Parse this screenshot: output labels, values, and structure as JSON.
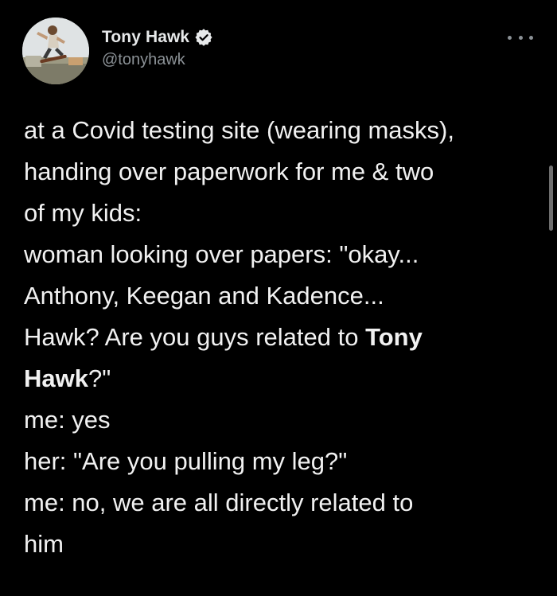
{
  "author": {
    "display_name": "Tony Hawk",
    "handle": "@tonyhawk",
    "verified": true,
    "verified_color": "#e7e9ea",
    "avatar_icon": "skateboarder-photo-avatar"
  },
  "menu": {
    "icon": "more-horizontal-icon"
  },
  "tweet": {
    "lines": [
      {
        "pre": "at a Covid testing site (wearing masks),",
        "bold": "",
        "post": ""
      },
      {
        "pre": "handing over paperwork for me & two",
        "bold": "",
        "post": ""
      },
      {
        "pre": "of my kids:",
        "bold": "",
        "post": ""
      },
      {
        "pre": "woman looking over papers: \"okay...",
        "bold": "",
        "post": ""
      },
      {
        "pre": "Anthony, Keegan and Kadence...",
        "bold": "",
        "post": ""
      },
      {
        "pre": "Hawk? Are you guys related to ",
        "bold": "Tony",
        "post": ""
      },
      {
        "pre": "",
        "bold": "Hawk",
        "post": "?\""
      },
      {
        "pre": "me: yes",
        "bold": "",
        "post": ""
      },
      {
        "pre": "her: \"Are you pulling my leg?\"",
        "bold": "",
        "post": ""
      },
      {
        "pre": "me: no, we are all directly related to",
        "bold": "",
        "post": ""
      },
      {
        "pre": "him",
        "bold": "",
        "post": ""
      }
    ]
  },
  "colors": {
    "background": "#000000",
    "text": "#e7e9ea",
    "secondary": "#8b9196"
  }
}
